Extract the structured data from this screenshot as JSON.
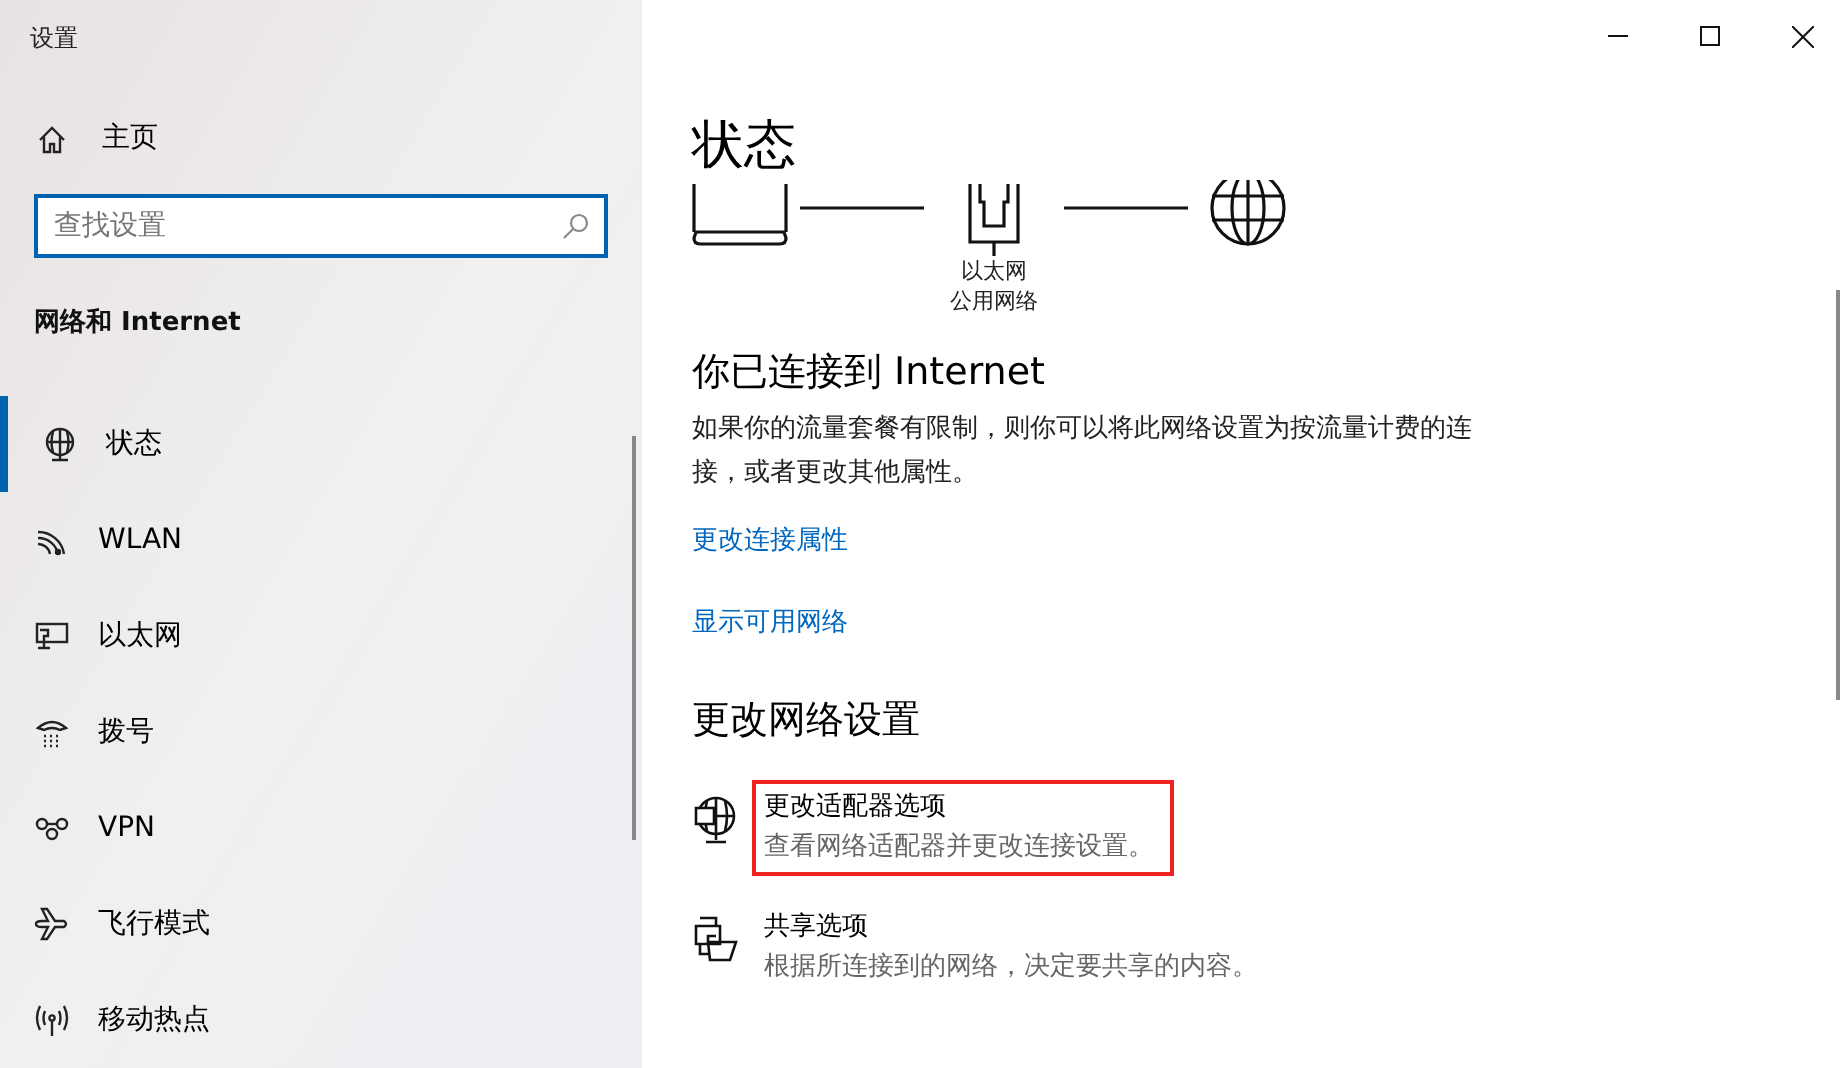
{
  "window": {
    "title": "设置"
  },
  "sidebar": {
    "home": "主页",
    "search": {
      "placeholder": "查找设置"
    },
    "section": "网络和 Internet",
    "items": [
      {
        "label": "状态",
        "selected": true
      },
      {
        "label": "WLAN",
        "selected": false
      },
      {
        "label": "以太网",
        "selected": false
      },
      {
        "label": "拨号",
        "selected": false
      },
      {
        "label": "VPN",
        "selected": false
      },
      {
        "label": "飞行模式",
        "selected": false
      },
      {
        "label": "移动热点",
        "selected": false
      }
    ]
  },
  "main": {
    "title": "状态",
    "diagram": {
      "adapter": "以太网",
      "network": "公用网络"
    },
    "connection_heading": "你已连接到 Internet",
    "connection_text": "如果你的流量套餐有限制，则你可以将此网络设置为按流量计费的连接，或者更改其他属性。",
    "links": [
      "更改连接属性",
      "显示可用网络"
    ],
    "settings_heading": "更改网络设置",
    "options": [
      {
        "title": "更改适配器选项",
        "description": "查看网络适配器并更改连接设置。",
        "highlighted": true
      },
      {
        "title": "共享选项",
        "description": "根据所连接到的网络，决定要共享的内容。",
        "highlighted": false
      }
    ]
  }
}
